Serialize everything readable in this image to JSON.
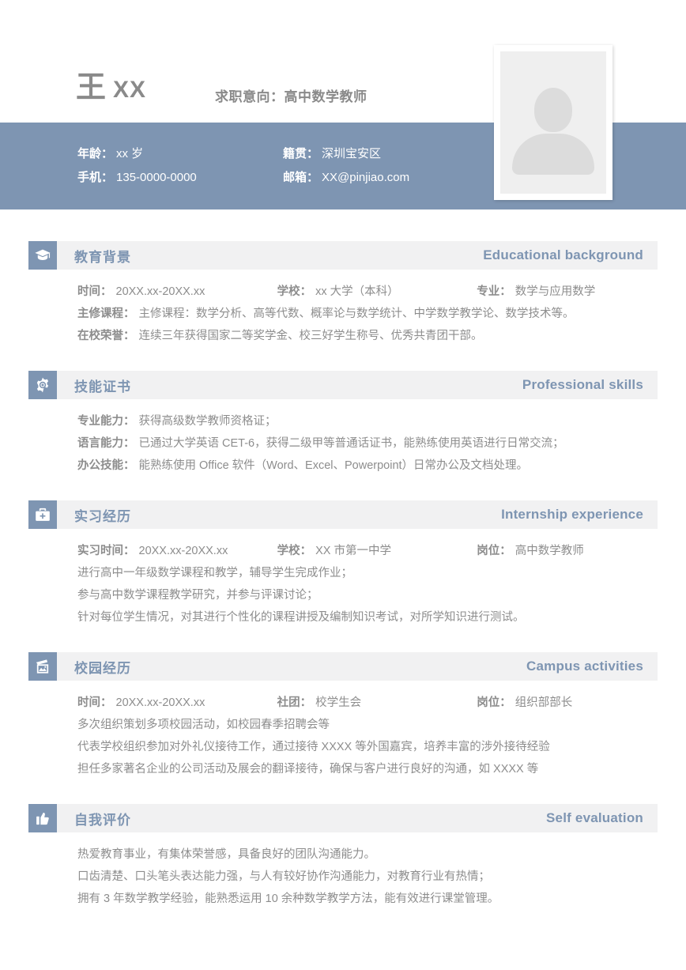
{
  "header": {
    "name_surname": "王",
    "name_given": "XX",
    "objective": "求职意向：高中数学教师",
    "photo_alt": "person-silhouette",
    "contacts": [
      [
        {
          "label": "年龄：",
          "value": "xx 岁"
        },
        {
          "label": "籍贯：",
          "value": "深圳宝安区"
        }
      ],
      [
        {
          "label": "手机：",
          "value": "135-0000-0000"
        },
        {
          "label": "邮箱：",
          "value": "XX@pinjiao.com"
        }
      ]
    ]
  },
  "colors": {
    "accent": "#7e95b2",
    "bar_bg": "#f1f1f2",
    "body_text": "#8d8d8d",
    "name_text": "#8a8a8a",
    "photo_inner": "#efefef",
    "photo_silhouette": "#dcdcdc"
  },
  "sections": {
    "education": {
      "icon": "graduation-cap-icon",
      "title_cn": "教育背景",
      "title_en": "Educational background",
      "meta": [
        {
          "label": "时间：",
          "value": "20XX.xx-20XX.xx"
        },
        {
          "label": "学校：",
          "value": "xx 大学（本科）"
        },
        {
          "label": "专业：",
          "value": "数学与应用数学"
        }
      ],
      "lines": [
        {
          "label": "主修课程：",
          "text": "主修课程：数学分析、高等代数、概率论与数学统计、中学数学教学论、数学技术等。"
        },
        {
          "label": "在校荣誉：",
          "text": "连续三年获得国家二等奖学金、校三好学生称号、优秀共青团干部。"
        }
      ]
    },
    "skills": {
      "icon": "gear-icon",
      "title_cn": "技能证书",
      "title_en": "Professional skills",
      "lines": [
        {
          "label": "专业能力：",
          "text": "获得高级数学教师资格证；"
        },
        {
          "label": "语言能力：",
          "text": "已通过大学英语 CET-6，获得二级甲等普通话证书，能熟练使用英语进行日常交流；"
        },
        {
          "label": "办公技能：",
          "text": "能熟练使用 Office 软件（Word、Excel、Powerpoint）日常办公及文档处理。"
        }
      ]
    },
    "internship": {
      "icon": "briefcase-icon",
      "title_cn": "实习经历",
      "title_en": "Internship experience",
      "meta": [
        {
          "label": "实习时间：",
          "value": "20XX.xx-20XX.xx"
        },
        {
          "label": "学校：",
          "value": "XX 市第一中学"
        },
        {
          "label": "岗位：",
          "value": "高中数学教师"
        }
      ],
      "lines": [
        {
          "text": "进行高中一年级数学课程和教学，辅导学生完成作业；"
        },
        {
          "text": "参与高中数学课程教学研究，并参与评课讨论；"
        },
        {
          "text": "针对每位学生情况，对其进行个性化的课程讲授及编制知识考试，对所学知识进行测试。"
        }
      ]
    },
    "campus": {
      "icon": "picture-frame-icon",
      "title_cn": "校园经历",
      "title_en": "Campus activities",
      "meta": [
        {
          "label": "时间：",
          "value": "20XX.xx-20XX.xx"
        },
        {
          "label": "社团：",
          "value": "校学生会"
        },
        {
          "label": "岗位：",
          "value": "组织部部长"
        }
      ],
      "lines": [
        {
          "text": "多次组织策划多项校园活动，如校园春季招聘会等"
        },
        {
          "text": "代表学校组织参加对外礼仪接待工作，通过接待 XXXX 等外国嘉宾，培养丰富的涉外接待经验"
        },
        {
          "text": "担任多家著名企业的公司活动及展会的翻译接待，确保与客户进行良好的沟通，如 XXXX 等"
        }
      ]
    },
    "self": {
      "icon": "thumbs-up-icon",
      "title_cn": "自我评价",
      "title_en": "Self evaluation",
      "lines": [
        {
          "text": "热爱教育事业，有集体荣誉感，具备良好的团队沟通能力。"
        },
        {
          "text": "口齿清楚、口头笔头表达能力强，与人有较好协作沟通能力，对教育行业有热情；"
        },
        {
          "text": "拥有 3 年数学教学经验，能熟悉运用 10 余种数学教学方法，能有效进行课堂管理。"
        }
      ]
    }
  }
}
